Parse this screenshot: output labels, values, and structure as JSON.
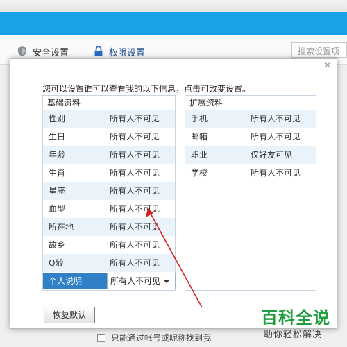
{
  "app": {
    "tabs": [
      {
        "label": "安全设置"
      },
      {
        "label": "权限设置"
      }
    ],
    "search": {
      "placeholder": "搜索设置项"
    },
    "background_checkbox_label": "只能通过帐号或昵称找到我"
  },
  "dialog": {
    "instruction": "您可以设置谁可以查看我的以下信息，点击可改变设置。",
    "basic": {
      "header": "基础资料",
      "rows": [
        {
          "label": "性别",
          "value": "所有人不可见"
        },
        {
          "label": "生日",
          "value": "所有人不可见"
        },
        {
          "label": "年龄",
          "value": "所有人不可见"
        },
        {
          "label": "生肖",
          "value": "所有人不可见"
        },
        {
          "label": "星座",
          "value": "所有人不可见"
        },
        {
          "label": "血型",
          "value": "所有人不可见"
        },
        {
          "label": "所在地",
          "value": "所有人不可见"
        },
        {
          "label": "故乡",
          "value": "所有人不可见"
        },
        {
          "label": "Q龄",
          "value": "所有人不可见"
        },
        {
          "label": "个人说明",
          "value": "所有人不可见",
          "selected": true
        }
      ]
    },
    "extended": {
      "header": "扩展资料",
      "rows": [
        {
          "label": "手机",
          "value": "所有人不可见"
        },
        {
          "label": "邮箱",
          "value": "所有人不可见"
        },
        {
          "label": "职业",
          "value": "仅好友可见"
        },
        {
          "label": "学校",
          "value": "所有人不可见"
        }
      ]
    },
    "restore_button": "恢复默认",
    "close_symbol": "×"
  },
  "watermark": {
    "title": "百科全说",
    "subtitle": "助你轻松解决"
  },
  "colors": {
    "header_blue": "#1aa2e6",
    "selected_blue": "#2f80c7",
    "row_alt": "#eaf3fa",
    "annotation_red": "#d42020",
    "watermark_green": "#1e9e3c"
  },
  "icons": {
    "security_tab": "shield-icon",
    "permission_tab": "lock-icon",
    "dialog_close": "close-icon",
    "select_caret": "caret-down-icon"
  }
}
